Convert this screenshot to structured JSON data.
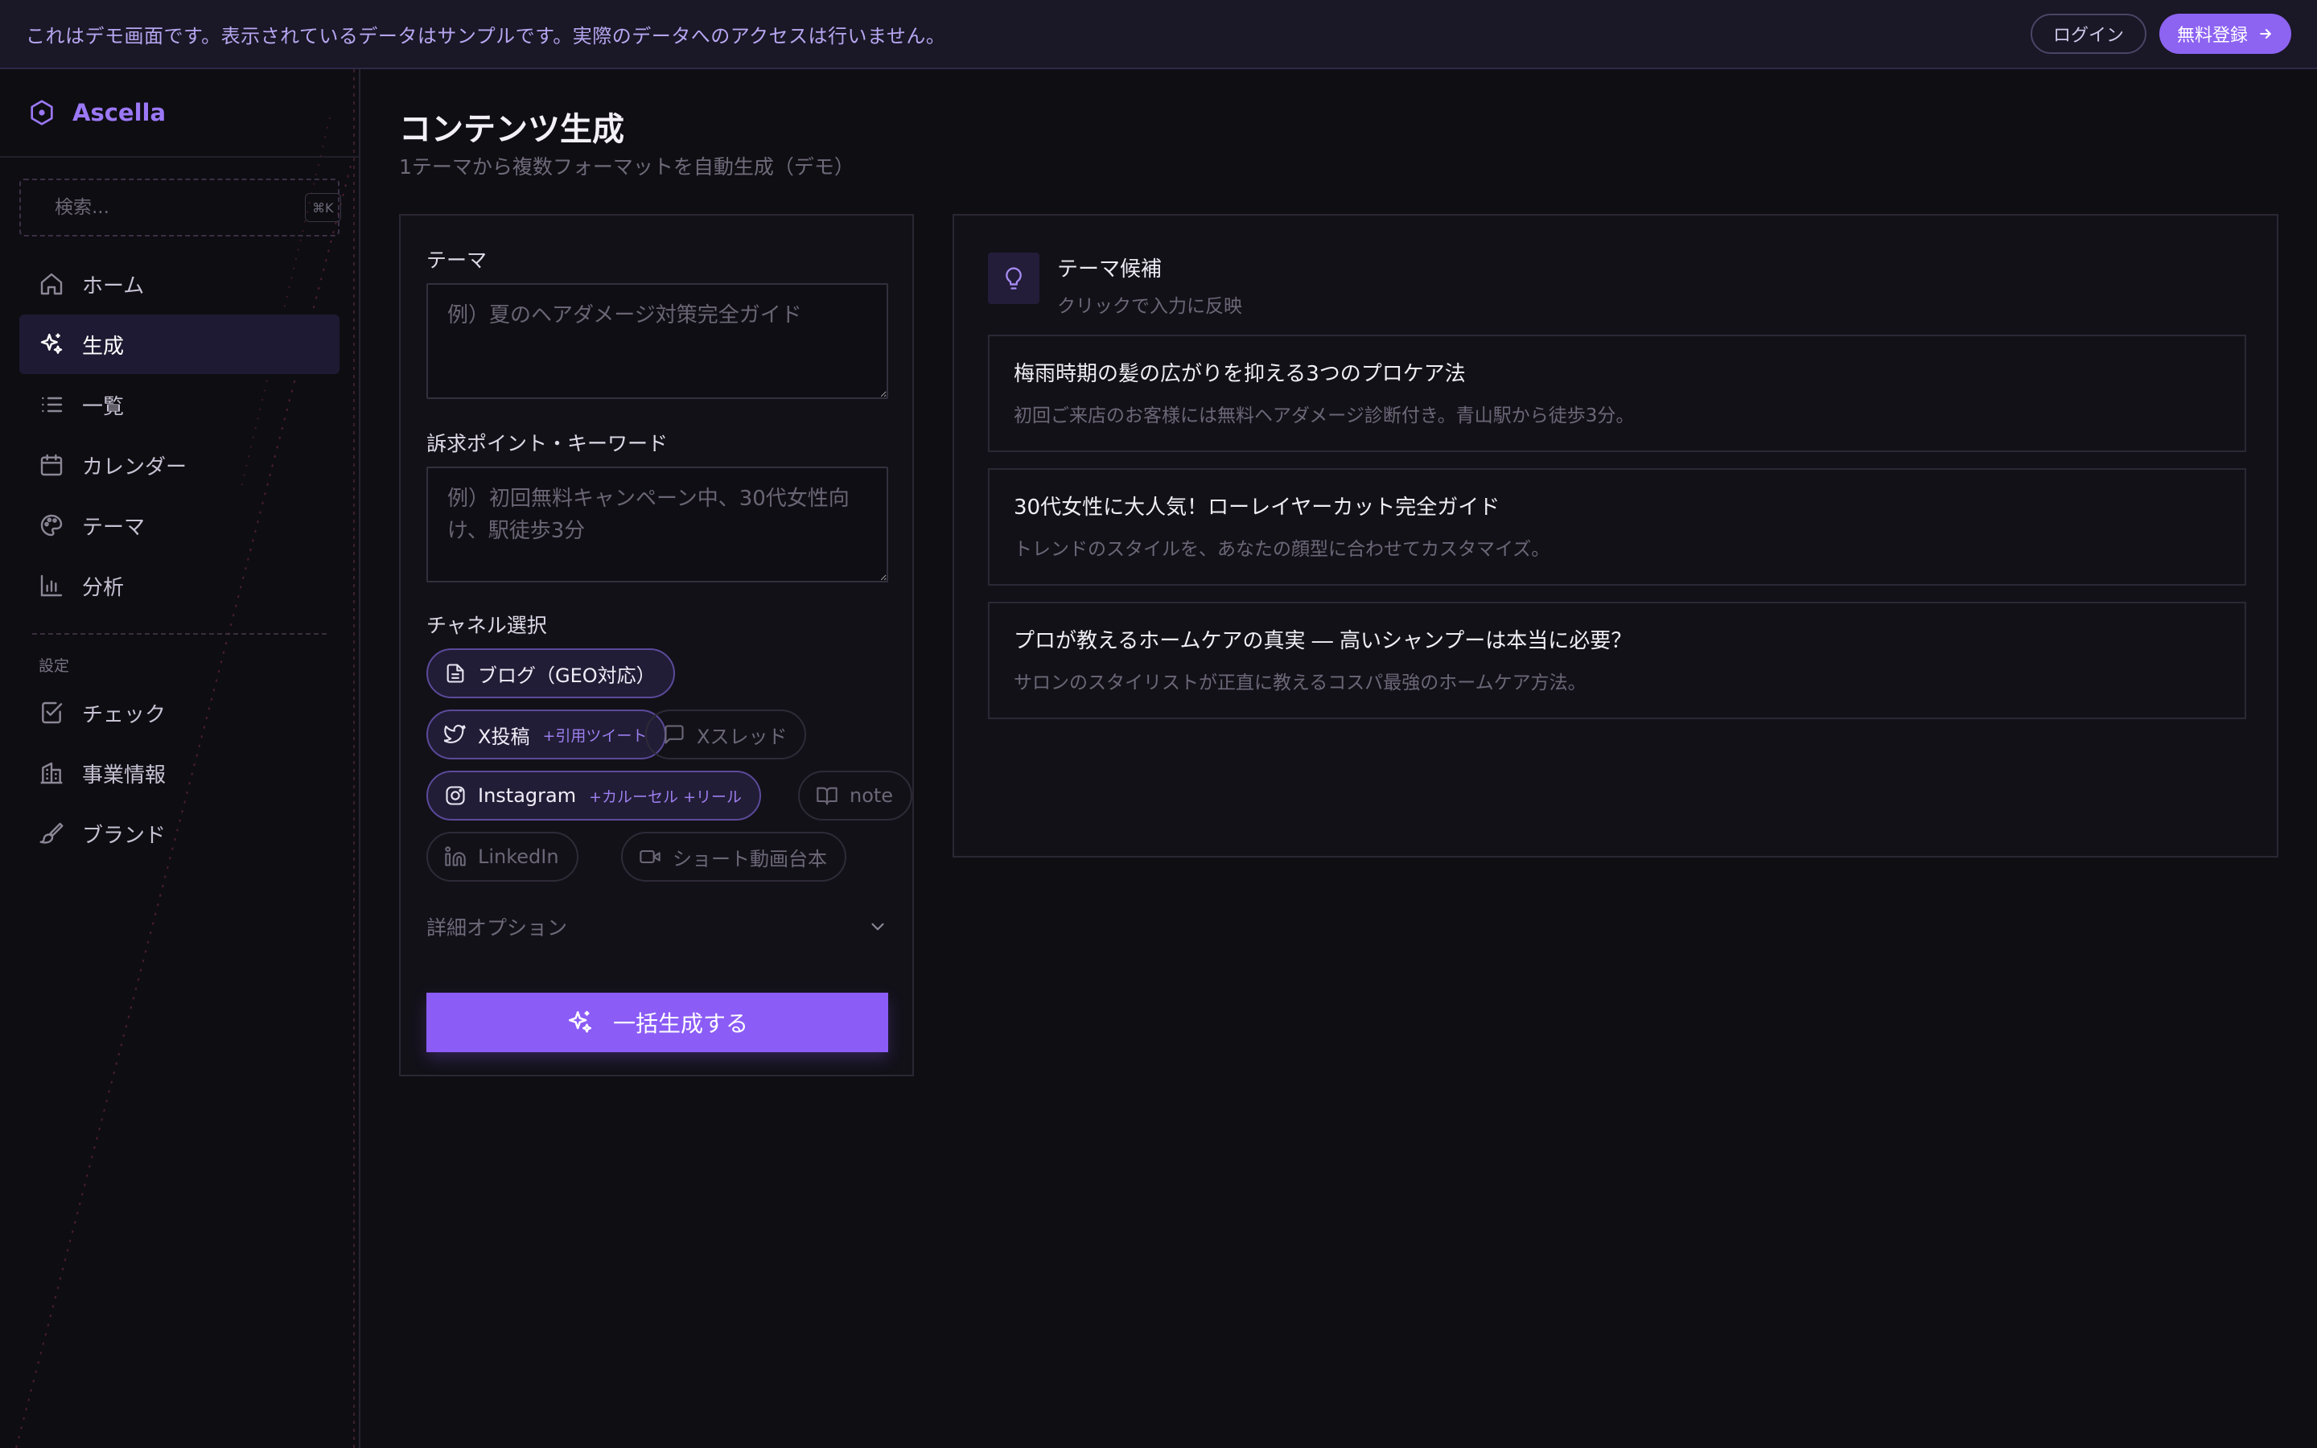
{
  "banner": {
    "text": "これはデモ画面です。表示されているデータはサンプルです。実際のデータへのアクセスは行いません。",
    "login_label": "ログイン",
    "signup_label": "無料登録"
  },
  "sidebar": {
    "brand": "Ascella",
    "search_placeholder": "検索...",
    "search_shortcut": "⌘K",
    "items": [
      {
        "label": "ホーム",
        "icon": "home-icon",
        "active": false
      },
      {
        "label": "生成",
        "icon": "sparkles-icon",
        "active": true
      },
      {
        "label": "一覧",
        "icon": "list-icon",
        "active": false
      },
      {
        "label": "カレンダー",
        "icon": "calendar-icon",
        "active": false
      },
      {
        "label": "テーマ",
        "icon": "palette-icon",
        "active": false
      },
      {
        "label": "分析",
        "icon": "bar-chart-icon",
        "active": false
      }
    ],
    "section_label": "設定",
    "settings_items": [
      {
        "label": "チェック",
        "icon": "check-square-icon"
      },
      {
        "label": "事業情報",
        "icon": "building-icon"
      },
      {
        "label": "ブランド",
        "icon": "brush-icon"
      }
    ]
  },
  "main": {
    "title": "コンテンツ生成",
    "subtitle": "1テーマから複数フォーマットを自動生成（デモ）",
    "form": {
      "theme_label": "テーマ",
      "theme_placeholder": "例）夏のヘアダメージ対策完全ガイド",
      "appeal_label": "訴求ポイント・キーワード",
      "appeal_placeholder": "例）初回無料キャンペーン中、30代女性向け、駅徒歩3分",
      "channel_label": "チャネル選択",
      "channels": [
        {
          "label": "ブログ（GEO対応）",
          "extra": "",
          "selected": true,
          "icon": "file-text-icon"
        },
        {
          "label": "X投稿",
          "extra": "+引用ツイート",
          "selected": true,
          "icon": "twitter-icon"
        },
        {
          "label": "Xスレッド",
          "extra": "",
          "selected": false,
          "icon": "message-square-icon"
        },
        {
          "label": "Instagram",
          "extra": "+カルーセル +リール",
          "selected": true,
          "icon": "instagram-icon"
        },
        {
          "label": "note",
          "extra": "",
          "selected": false,
          "icon": "book-open-icon"
        },
        {
          "label": "LinkedIn",
          "extra": "",
          "selected": false,
          "icon": "linkedin-icon"
        },
        {
          "label": "ショート動画台本",
          "extra": "",
          "selected": false,
          "icon": "video-icon"
        }
      ],
      "details_label": "詳細オプション",
      "generate_label": "一括生成する"
    },
    "suggestions": {
      "title": "テーマ候補",
      "subtitle": "クリックで入力に反映",
      "items": [
        {
          "title": "梅雨時期の髪の広がりを抑える3つのプロケア法",
          "desc": "初回ご来店のお客様には無料ヘアダメージ診断付き。青山駅から徒歩3分。"
        },
        {
          "title": "30代女性に大人気！ローレイヤーカット完全ガイド",
          "desc": "トレンドのスタイルを、あなたの顔型に合わせてカスタマイズ。"
        },
        {
          "title": "プロが教えるホームケアの真実 ― 高いシャンプーは本当に必要？",
          "desc": "サロンのスタイリストが正直に教えるコスパ最強のホームケア方法。"
        }
      ]
    }
  },
  "colors": {
    "accent": "#8b5cf6",
    "brand": "#9b78f5",
    "background": "#0f0e13",
    "banner_bg": "#1a1726"
  }
}
